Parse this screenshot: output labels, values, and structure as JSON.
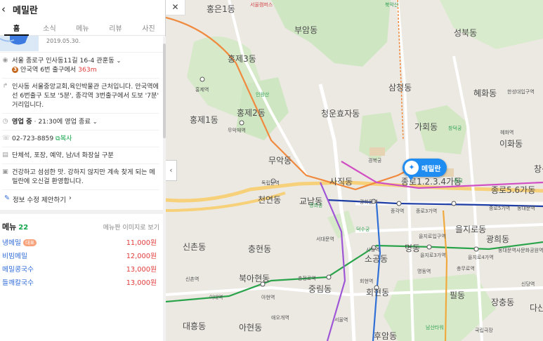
{
  "place": {
    "name": "메밀란",
    "tabs": [
      "홈",
      "소식",
      "메뉴",
      "리뷰",
      "사진"
    ],
    "photo_date": "2019.05.30.",
    "address": "서울 종로구 인사동11길 16-4 관훈동",
    "subway": {
      "line_num": "3",
      "text": "안국역 6번 출구에서 ",
      "distance": "363m"
    },
    "directions": "인사동 서울중앙교회,육인박물관 근처입니다. 안국역에선 6번출구 도보 '5분', 종각역 3번출구에서 도보 '7분' 거리입니다.",
    "hours": {
      "status": "영업 중",
      "detail": "· 21:30에 영업 종료"
    },
    "phone": "02-723-8859",
    "copy_label": "복사",
    "amenities": "단체석, 포장, 예약, 남/녀 화장실 구분",
    "description": "건강하고 섬섬한 맛. 강하지 않지만 계속 찾게 되는 메밀란에 오신걸 환영합니다.",
    "edit_label": "정보 수정 제안하기",
    "menu": {
      "label": "메뉴",
      "count": "22",
      "image_link": "메뉴판 이미지로 보기",
      "items": [
        {
          "name": "냉메밀",
          "tag": "대표",
          "price": "11,000원"
        },
        {
          "name": "비빔메밀",
          "tag": "",
          "price": "12,000원"
        },
        {
          "name": "메밀콩국수",
          "tag": "",
          "price": "13,000원"
        },
        {
          "name": "들깨칼국수",
          "tag": "",
          "price": "13,000원"
        }
      ]
    }
  },
  "map": {
    "pin_label": "메밀란",
    "districts": [
      "홍은1동",
      "부암동",
      "성북동",
      "홍제3동",
      "삼청동",
      "혜화동",
      "홍제2동",
      "홍제1동",
      "청운효자동",
      "가회동",
      "이화동",
      "무악동",
      "사직동",
      "종로1.2.3.4가동",
      "종로5.6가동",
      "천연동",
      "교남동",
      "신촌동",
      "충현동",
      "명동",
      "을지로동",
      "광희동",
      "북아현동",
      "중림동",
      "소공동",
      "회현동",
      "필동",
      "장충동",
      "대흥동",
      "아현동",
      "후암동",
      "다산동",
      "창신"
    ],
    "places": [
      "서울캠퍼스",
      "홍은1동",
      "홍제역",
      "무악재역",
      "독립문역",
      "서대문역",
      "광화문역",
      "종각역",
      "시청역",
      "을지로입구역",
      "을지로3가역",
      "을지로4가역",
      "동대문역사문화공원역",
      "충무로역",
      "명동역",
      "회현역",
      "서울역",
      "충정로역",
      "아현역",
      "이대역",
      "신촌역",
      "애오개역",
      "종로3가역",
      "종로5가역",
      "동대문역",
      "혜화역",
      "한성대입구역",
      "경복궁",
      "경희궁",
      "덕수궁",
      "창덕궁",
      "종묘",
      "북악산",
      "인왕산",
      "남산타워",
      "국립극장",
      "신당역"
    ]
  }
}
